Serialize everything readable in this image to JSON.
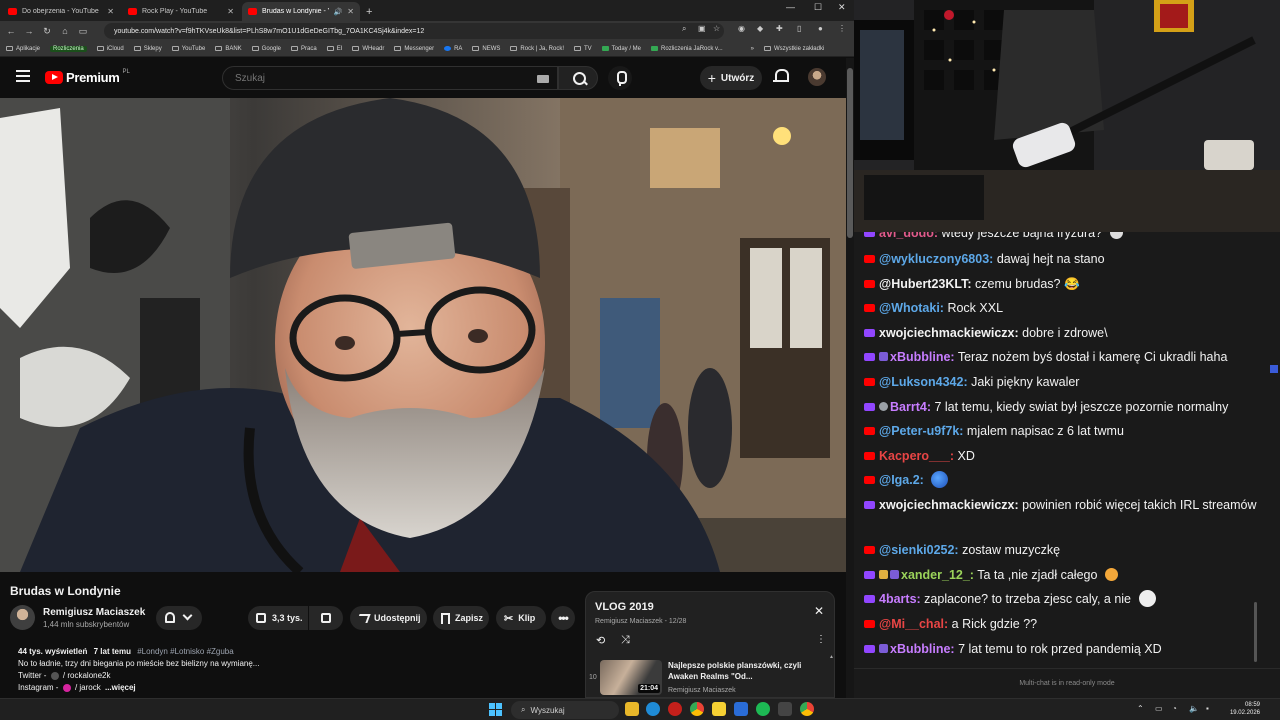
{
  "browser": {
    "tabs": [
      {
        "title": "Do obejrzenia - YouTube",
        "active": false
      },
      {
        "title": "Rock Play - YouTube",
        "active": false
      },
      {
        "title": "Brudas w Londynie - YouTu",
        "active": true
      }
    ],
    "url": "youtube.com/watch?v=f9hTKVseUk8&list=PLhS8w7mO1U1dGeDeGITbg_7OA1KC4Sj4k&index=12",
    "bookmarks": [
      "Aplikacje",
      "Rozliczenia",
      "iCloud",
      "Sklepy",
      "YouTube",
      "BANK",
      "Google",
      "Praca",
      "EI",
      "WHeadr",
      "Messenger",
      "RA",
      "NEWS",
      "Rock | Ja, Rock!",
      "TV",
      "Today / Me",
      "Rozliczenia JaRock v...",
      "Wszystkie zakładki"
    ]
  },
  "youtube": {
    "logo_text": "Premium",
    "logo_region": "PL",
    "search_placeholder": "Szukaj",
    "create_label": "Utwórz",
    "video": {
      "title": "Brudas w Londynie",
      "channel": "Remigiusz Maciaszek",
      "subscribers": "1,44 mln subskrybentów",
      "likes": "3,3 tys.",
      "share_label": "Udostępnij",
      "save_label": "Zapisz",
      "clip_label": "Klip",
      "more_label": "•••",
      "views": "44 tys. wyświetleń",
      "age": "7 lat temu",
      "hashtags": "#Londyn #Lotnisko #Zguba",
      "desc_line1": "No to ładnie, trzy dni biegania po mieście bez bielizny na wymianę...",
      "desc_line2_prefix": "Twitter -",
      "desc_line2_handle": "/ rockalone2k",
      "desc_line3_prefix": "Instagram -",
      "desc_line3_handle": "/ jarock",
      "desc_more": "...więcej"
    },
    "playlist": {
      "title": "VLOG 2019",
      "subtitle": "Remigiusz Maciaszek - 12/28",
      "item_index": "10",
      "item_title": "Najlepsze polskie planszówki, czyli Awaken Realms \"Od...",
      "item_channel": "Remigiusz Maciaszek",
      "item_duration": "21:04"
    }
  },
  "chat": {
    "top_fragment": {
      "user": "avi_dodo:",
      "text": "wtedy jeszcze bajna fryzura?",
      "color": "#e05a8a"
    },
    "messages": [
      {
        "platform": "yt",
        "user": "@wykluczony6803:",
        "text": "dawaj hejt na stano",
        "color": "#5da8e8"
      },
      {
        "platform": "yt",
        "user": "@Hubert23KLT:",
        "text": "czemu brudas? 😂",
        "color": "#f2f2f2"
      },
      {
        "platform": "yt",
        "user": "@Whotaki:",
        "text": "Rock XXL",
        "color": "#5da8e8"
      },
      {
        "platform": "tw",
        "user": "xwojciechmackiewiczx:",
        "text": "dobre i zdrowe\\",
        "color": "#f2f2f2"
      },
      {
        "platform": "tw",
        "user": "xBubbline:",
        "text": "Teraz nożem byś dostał i kamerę Ci ukradli haha",
        "color": "#c77dff"
      },
      {
        "platform": "yt",
        "user": "@Lukson4342:",
        "text": "Jaki piękny kawaler",
        "color": "#5da8e8"
      },
      {
        "platform": "tw",
        "user": "Barrt4:",
        "text": "7 lat temu, kiedy swiat był jeszcze pozornie normalny",
        "color": "#c77dff"
      },
      {
        "platform": "yt",
        "user": "@Peter-u9f7k:",
        "text": "mjalem napisac z 6 lat twmu",
        "color": "#5da8e8"
      },
      {
        "platform": "yt",
        "user": "Kacpero___:",
        "text": "XD",
        "color": "#e84545"
      },
      {
        "platform": "yt",
        "user": "@Iga.2:",
        "text": "",
        "color": "#5da8e8"
      },
      {
        "platform": "tw",
        "user": "xwojciechmackiewiczx:",
        "text": "powinien robić więcej takich IRL streamów",
        "color": "#f2f2f2"
      },
      {
        "platform": "yt",
        "user": "@sienki0252:",
        "text": "zostaw muzyczkę",
        "color": "#5da8e8"
      },
      {
        "platform": "tw",
        "user": "xander_12_:",
        "text": "Ta ta ,nie zjadł całego",
        "color": "#9bd35a"
      },
      {
        "platform": "tw",
        "user": "4barts:",
        "text": "zaplacone? to trzeba zjesc caly, a nie",
        "color": "#c77dff"
      },
      {
        "platform": "yt",
        "user": "@Mi__chal:",
        "text": "a Rick gdzie ??",
        "color": "#e84545"
      },
      {
        "platform": "tw",
        "user": "xBubbline:",
        "text": "7 lat temu to rok przed pandemią XD",
        "color": "#c77dff"
      }
    ],
    "footer": "Multi-chat is in read-only mode"
  },
  "taskbar": {
    "search_label": "Wyszukaj",
    "time": "08:59",
    "date": "19.02.2026"
  },
  "colors": {
    "youtube_red": "#ff0000",
    "twitch_purple": "#9146ff",
    "yt_bg": "#0f0f0f",
    "chat_bg": "#1a1a1a"
  }
}
